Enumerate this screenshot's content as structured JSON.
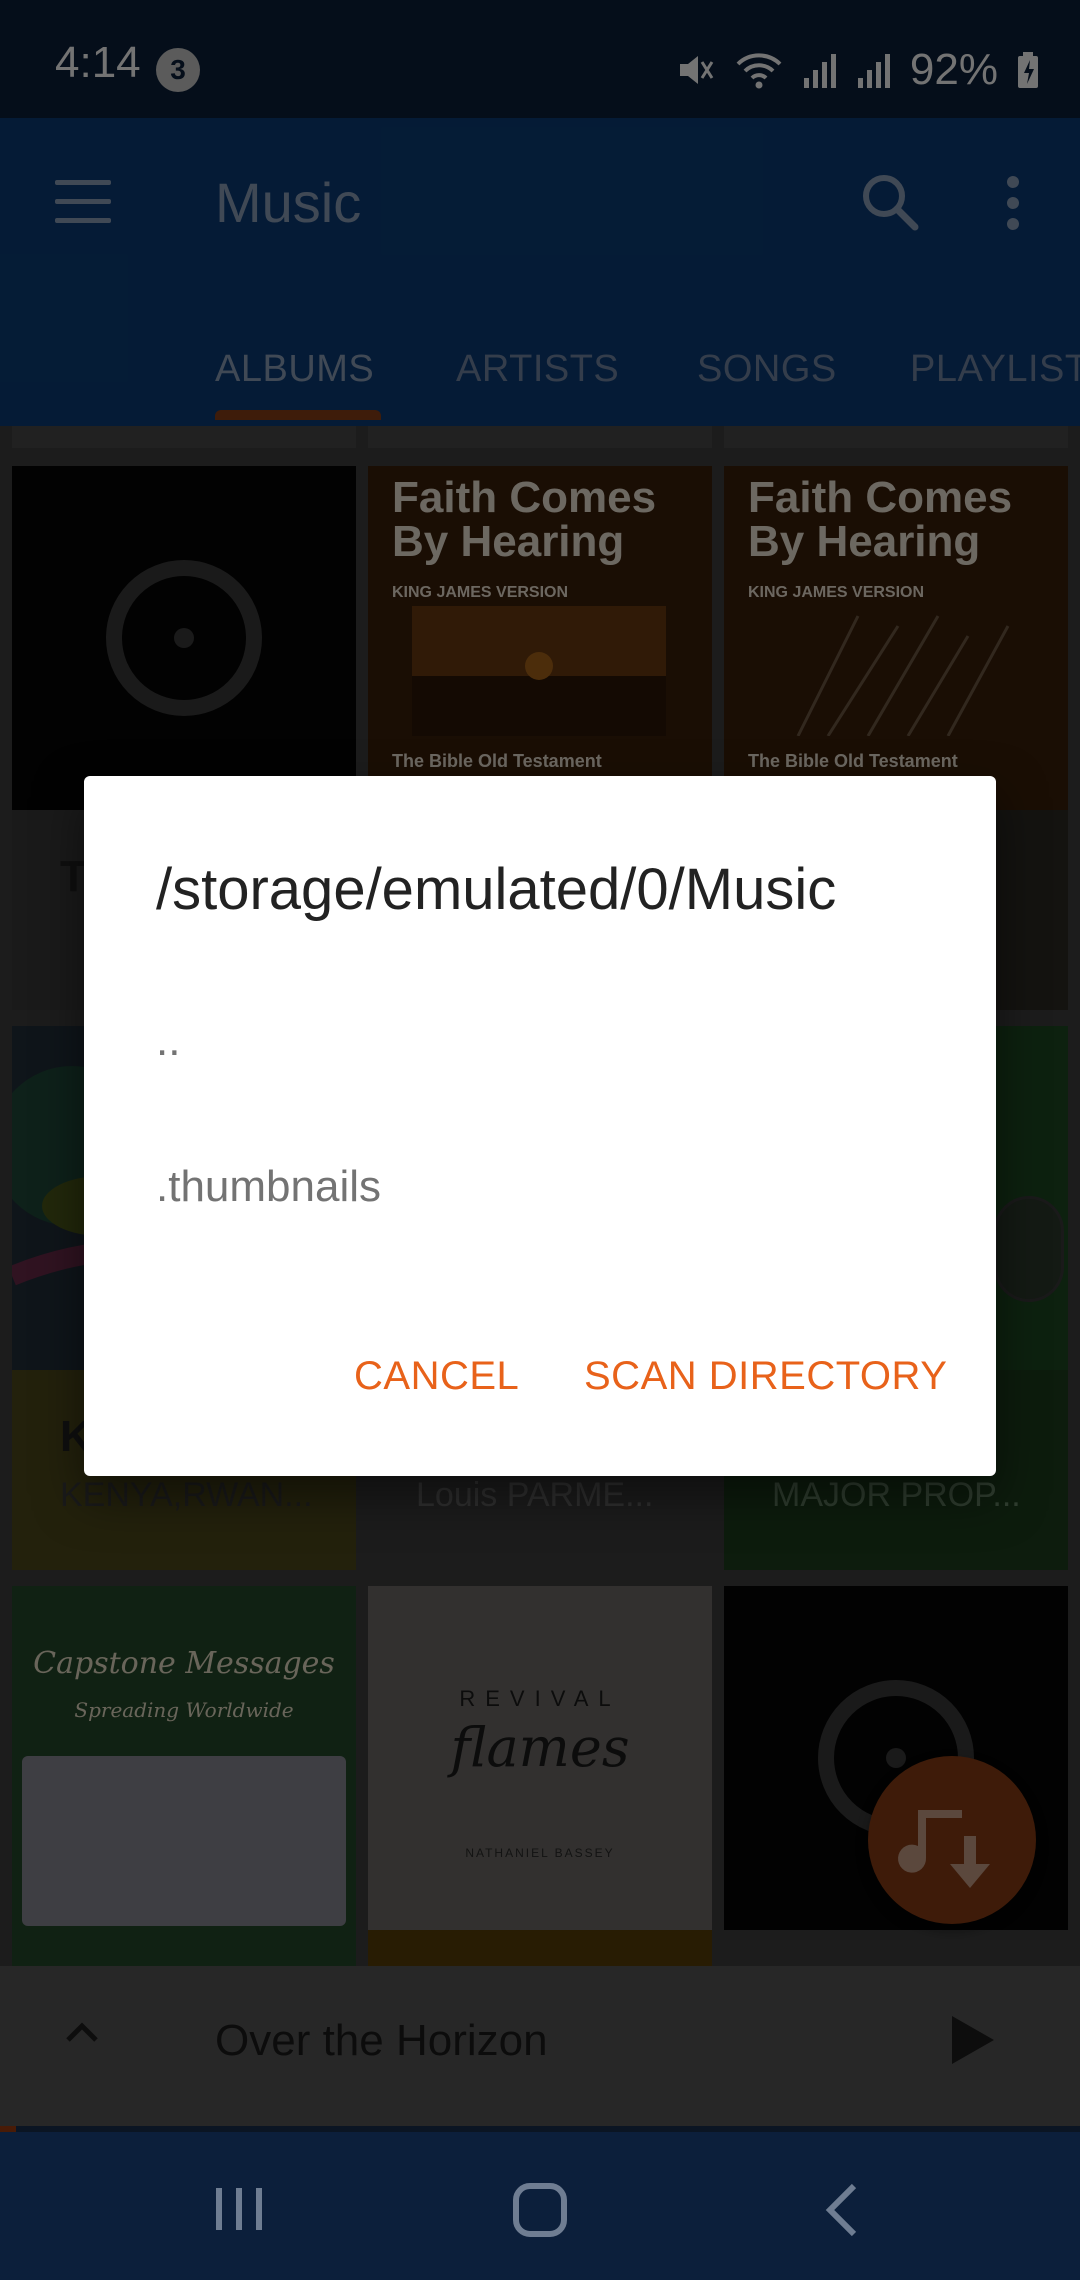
{
  "status_bar": {
    "time": "4:14",
    "notification_count": "3",
    "battery": "92%"
  },
  "app_bar": {
    "title": "Music"
  },
  "tabs": [
    {
      "label": "ALBUMS",
      "active": true
    },
    {
      "label": "ARTISTS",
      "active": false
    },
    {
      "label": "SONGS",
      "active": false
    },
    {
      "label": "PLAYLIST",
      "active": false
    }
  ],
  "albums": [
    {
      "title": "T",
      "subtitle": "T"
    },
    {
      "art_title": "Faith Comes By Hearing",
      "art_edition": "KING JAMES VERSION",
      "art_sub": "The Bible Old Testament"
    },
    {
      "art_title": "Faith Comes By Hearing",
      "art_edition": "KING JAMES VERSION",
      "art_sub": "The Bible Old Testament"
    },
    {
      "title": "K",
      "subtitle": "KENYA,RWAN..."
    },
    {
      "subtitle": "Louis PARME..."
    },
    {
      "subtitle": "MAJOR PROP..."
    },
    {
      "art_heading": "Capstone Messages",
      "art_sub": "Spreading Worldwide"
    },
    {
      "art_heading_1": "REVIVAL",
      "art_heading_2": "flames",
      "art_artist": "NATHANIEL BASSEY"
    },
    {}
  ],
  "dialog": {
    "title": "/storage/emulated/0/Music",
    "items": [
      "..",
      ".thumbnails"
    ],
    "cancel_label": "CANCEL",
    "scan_label": "SCAN DIRECTORY"
  },
  "player": {
    "song": "Over the Horizon",
    "progress_percent": 1.5
  },
  "colors": {
    "accent": "#e8621a",
    "app_bar": "#1565c0",
    "status_bar": "#0d47a1"
  }
}
